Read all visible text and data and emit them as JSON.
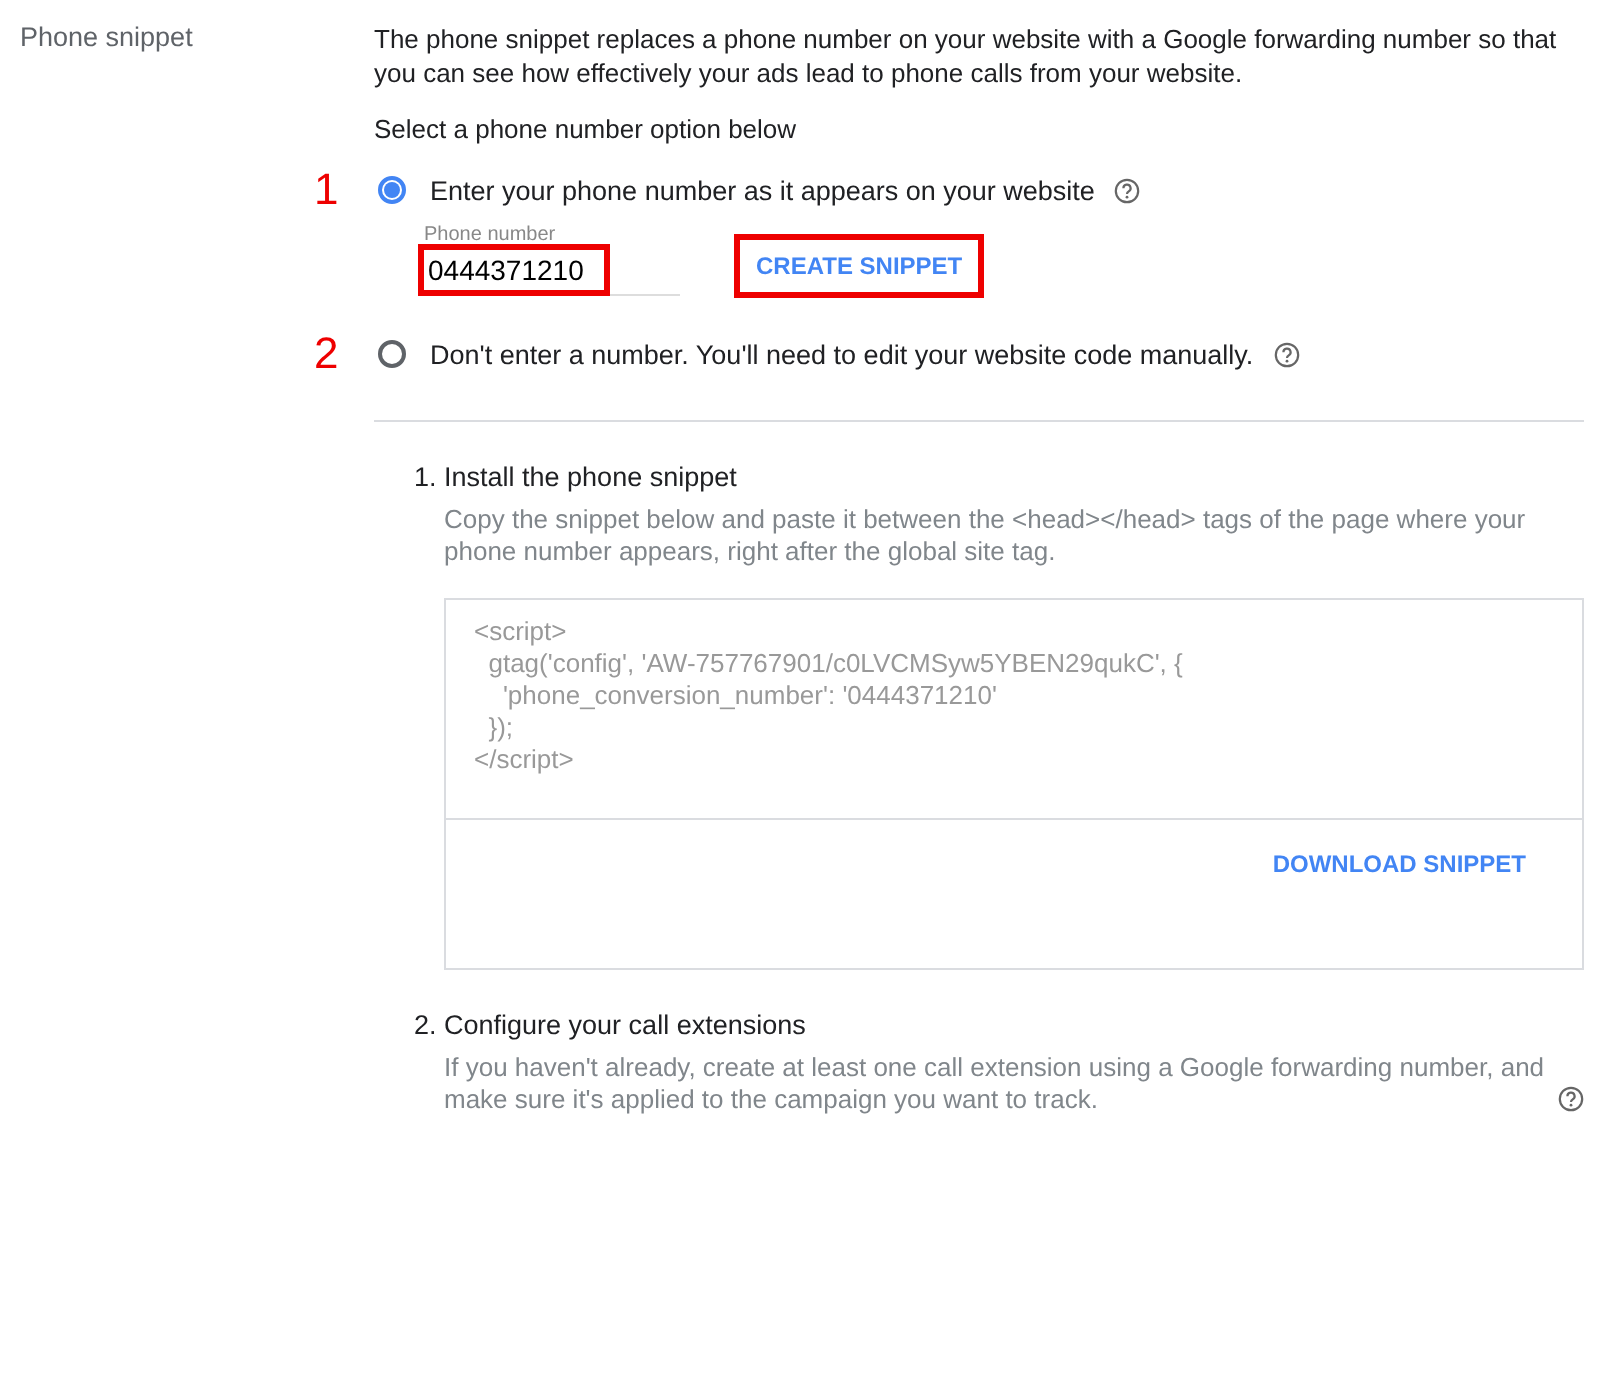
{
  "section_label": "Phone snippet",
  "intro": "The phone snippet replaces a phone number on your website with a Google forwarding number so that you can see how effectively your ads lead to phone calls from your website.",
  "prompt": "Select a phone number option below",
  "options": [
    {
      "marker": "1",
      "label": "Enter your phone number as it appears on your website",
      "selected": true,
      "kind": "number_entry",
      "field": {
        "label": "Phone number",
        "value": "0444371210",
        "highlighted": true
      },
      "button": {
        "label": "CREATE SNIPPET",
        "highlighted": true
      }
    },
    {
      "marker": "2",
      "label": "Don't enter a number. You'll need to edit your website code manually.",
      "selected": false,
      "kind": "plain"
    }
  ],
  "steps": [
    {
      "title": "1. Install the phone snippet",
      "description": "Copy the snippet below and paste it between the <head></head> tags of the page where your phone number appears, right after the global site tag.",
      "kind": "code",
      "code_lines": [
        "<script>",
        "  gtag('config', 'AW-757767901/c0LVCMSyw5YBEN29qukC', {",
        "    'phone_conversion_number': '0444371210'",
        "  });",
        "</script>"
      ],
      "action": "DOWNLOAD SNIPPET"
    },
    {
      "title": "2. Configure your call extensions",
      "description": "If you haven't already, create at least one call extension using a Google forwarding number, and make sure it's applied to the campaign you want to track.",
      "kind": "help"
    }
  ]
}
